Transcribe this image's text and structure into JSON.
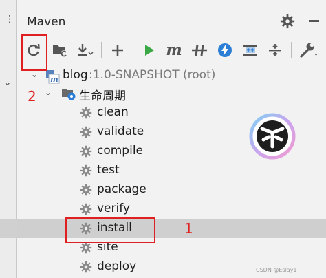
{
  "panel": {
    "title": "Maven"
  },
  "toolbar": {
    "buttons": [
      {
        "name": "reload-icon"
      },
      {
        "name": "generate-sources-icon"
      },
      {
        "name": "download-icon"
      },
      {
        "name": "add-icon"
      },
      {
        "name": "run-icon"
      },
      {
        "name": "execute-goal-icon",
        "glyph": "m"
      },
      {
        "name": "toggle-offline-icon"
      },
      {
        "name": "skip-tests-icon"
      },
      {
        "name": "show-dependencies-icon"
      },
      {
        "name": "collapse-all-icon"
      },
      {
        "name": "settings-wrench-icon"
      }
    ]
  },
  "tree": {
    "project": {
      "name": "blog",
      "suffix": ":1.0-SNAPSHOT (root)"
    },
    "lifecycle": {
      "label": "生命周期",
      "items": [
        "clean",
        "validate",
        "compile",
        "test",
        "package",
        "verify",
        "install",
        "site",
        "deploy"
      ],
      "selected": "install"
    }
  },
  "annotations": {
    "label1": "1",
    "label2": "2"
  },
  "watermark": "CSDN @Eslay1",
  "colors": {
    "accent_green": "#3aa845",
    "accent_blue": "#2d7fd6",
    "annotation_red": "#e02020"
  }
}
